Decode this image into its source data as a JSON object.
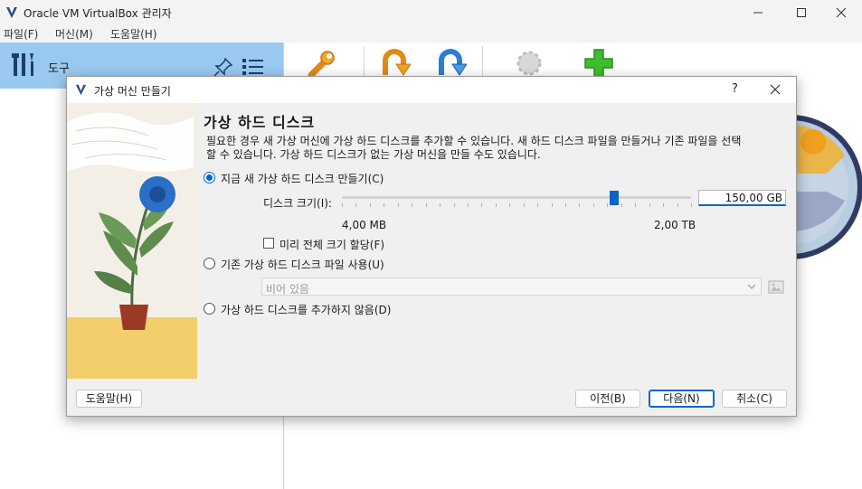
{
  "window": {
    "title": "Oracle VM VirtualBox 관리자",
    "menu": [
      "파일(F)",
      "머신(M)",
      "도움말(H)"
    ]
  },
  "sidebar": {
    "tools_label": "도구"
  },
  "dialog": {
    "title": "가상 머신 만들기",
    "help_glyph": "?",
    "page_title": "가상 하드 디스크",
    "description": "필요한 경우 새 가상 머신에 가상 하드 디스크를 추가할 수 있습니다. 새 하드 디스크 파일을 만들거나 기존 파일을 선택할 수 있습니다. 가상 하드 디스크가 없는 가상 머신을 만들 수도 있습니다.",
    "option_create": "지금 새 가상 하드 디스크 만들기(C)",
    "disk_size_label": "디스크 크기(I):",
    "disk_size_value": "150,00 GB",
    "disk_size_fraction": 0.78,
    "slider_min": "4,00 MB",
    "slider_max": "2,00 TB",
    "preallocate_label": "미리 전체 크기 할당(F)",
    "option_existing": "기존 가상 하드 디스크 파일 사용(U)",
    "existing_placeholder": "비어 있음",
    "option_none": "가상 하드 디스크를 추가하지 않음(D)",
    "buttons": {
      "help": "도움말(H)",
      "back": "이전(B)",
      "next": "다음(N)",
      "cancel": "취소(C)"
    },
    "selected_option": "create"
  },
  "colors": {
    "accent": "#0a64c8",
    "sidebar_selected": "#99c9ef"
  }
}
